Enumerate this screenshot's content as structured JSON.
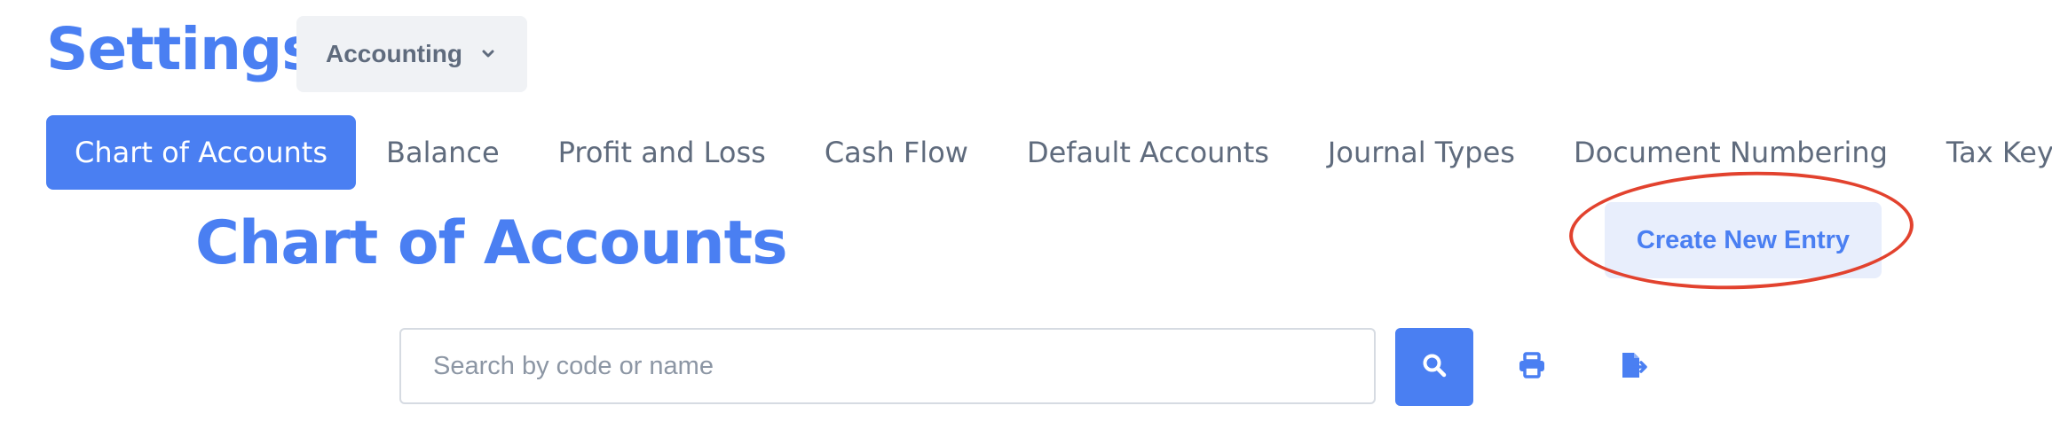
{
  "header": {
    "title": "Settings",
    "module_select": {
      "selected": "Accounting",
      "icon": "chevron-down-icon"
    }
  },
  "tabs": [
    {
      "label": "Chart of Accounts",
      "active": true
    },
    {
      "label": "Balance",
      "active": false
    },
    {
      "label": "Profit and Loss",
      "active": false
    },
    {
      "label": "Cash Flow",
      "active": false
    },
    {
      "label": "Default Accounts",
      "active": false
    },
    {
      "label": "Journal Types",
      "active": false
    },
    {
      "label": "Document Numbering",
      "active": false
    },
    {
      "label": "Tax Keys",
      "active": false
    }
  ],
  "main": {
    "section_title": "Chart of Accounts",
    "create_button_label": "Create New Entry"
  },
  "search": {
    "placeholder": "Search by code or name",
    "value": "",
    "button_icon": "search-icon"
  },
  "toolbar": {
    "print_icon": "print-icon",
    "export_icon": "export-file-icon"
  },
  "colors": {
    "accent": "#4a7ff2",
    "accent_light": "#e8eefc",
    "annotation": "#e2422e",
    "text_muted": "#5f6b7d"
  }
}
